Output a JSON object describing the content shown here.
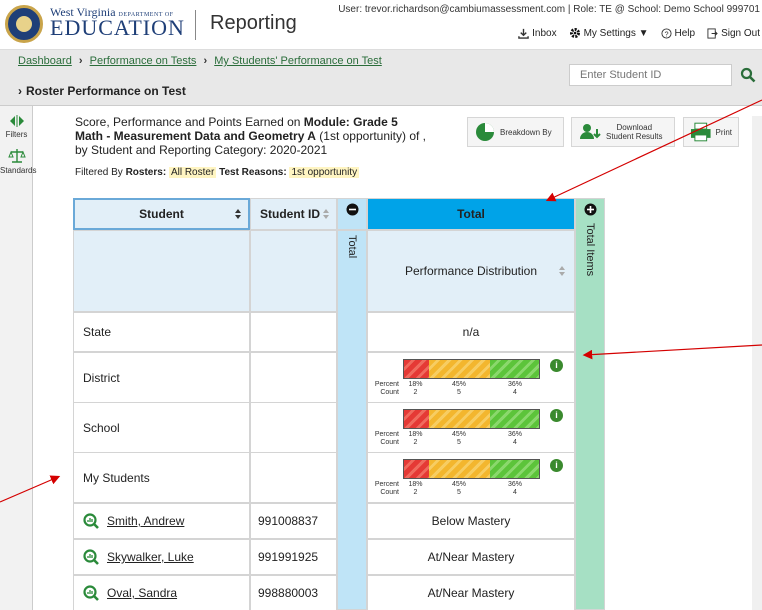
{
  "header": {
    "logo_top": "West Virginia",
    "logo_dept": "DEPARTMENT OF",
    "logo_main": "EDUCATION",
    "app_title": "Reporting",
    "user_line": "User: trevor.richardson@cambiumassessment.com  |  Role: TE @ School: Demo School 999701",
    "links": {
      "inbox": "Inbox",
      "settings": "My Settings ▼",
      "help": "Help",
      "signout": "Sign Out"
    }
  },
  "breadcrumb": {
    "items": [
      "Dashboard",
      "Performance on Tests",
      "My Students' Performance on Test"
    ],
    "title": "Roster Performance on Test"
  },
  "search": {
    "placeholder": "Enter Student ID"
  },
  "rail": {
    "filters": "Filters",
    "standards": "Standards"
  },
  "report": {
    "line1_pre": "Score, Performance and Points Earned on ",
    "line1_bold": "Module: Grade 5",
    "line2_bold": "Math - Measurement Data and Geometry A",
    "line2_post": " (1st opportunity) of ,",
    "line3": "by Student and Reporting Category: 2020-2021",
    "filtered_label": "Filtered By",
    "rosters_label": "Rosters:",
    "rosters_value": "All Roster",
    "reasons_label": "Test Reasons:",
    "reasons_value": "1st opportunity"
  },
  "tools": {
    "breakdown": "Breakdown By",
    "download_1": "Download",
    "download_2": "Student Results",
    "print": "Print"
  },
  "table": {
    "col_student": "Student",
    "col_sid": "Student ID",
    "col_total_vertical": "Total",
    "col_total": "Total",
    "col_items_vertical": "Total Items",
    "perf_dist": "Performance Distribution",
    "state": {
      "name": "State",
      "value": "n/a"
    },
    "aggregates": [
      {
        "name": "District",
        "percent_label": "Percent",
        "count_label": "Count",
        "percents": [
          "18%",
          "45%",
          "36%"
        ],
        "counts": [
          "2",
          "5",
          "4"
        ],
        "fractions": [
          0.18,
          0.45,
          0.36
        ]
      },
      {
        "name": "School",
        "percent_label": "Percent",
        "count_label": "Count",
        "percents": [
          "18%",
          "45%",
          "36%"
        ],
        "counts": [
          "2",
          "5",
          "4"
        ],
        "fractions": [
          0.18,
          0.45,
          0.36
        ]
      },
      {
        "name": "My Students",
        "percent_label": "Percent",
        "count_label": "Count",
        "percents": [
          "18%",
          "45%",
          "36%"
        ],
        "counts": [
          "2",
          "5",
          "4"
        ],
        "fractions": [
          0.18,
          0.45,
          0.36
        ]
      }
    ],
    "students": [
      {
        "name": "Smith, Andrew",
        "id": "991008837",
        "level": "Below Mastery"
      },
      {
        "name": "Skywalker, Luke",
        "id": "991991925",
        "level": "At/Near Mastery"
      },
      {
        "name": "Oval, Sandra",
        "id": "998880003",
        "level": "At/Near Mastery"
      }
    ]
  },
  "colors": {
    "accent": "#00a3e8",
    "brand": "#1f3f78",
    "link": "#2a6d3a",
    "arrow": "#d40000"
  }
}
